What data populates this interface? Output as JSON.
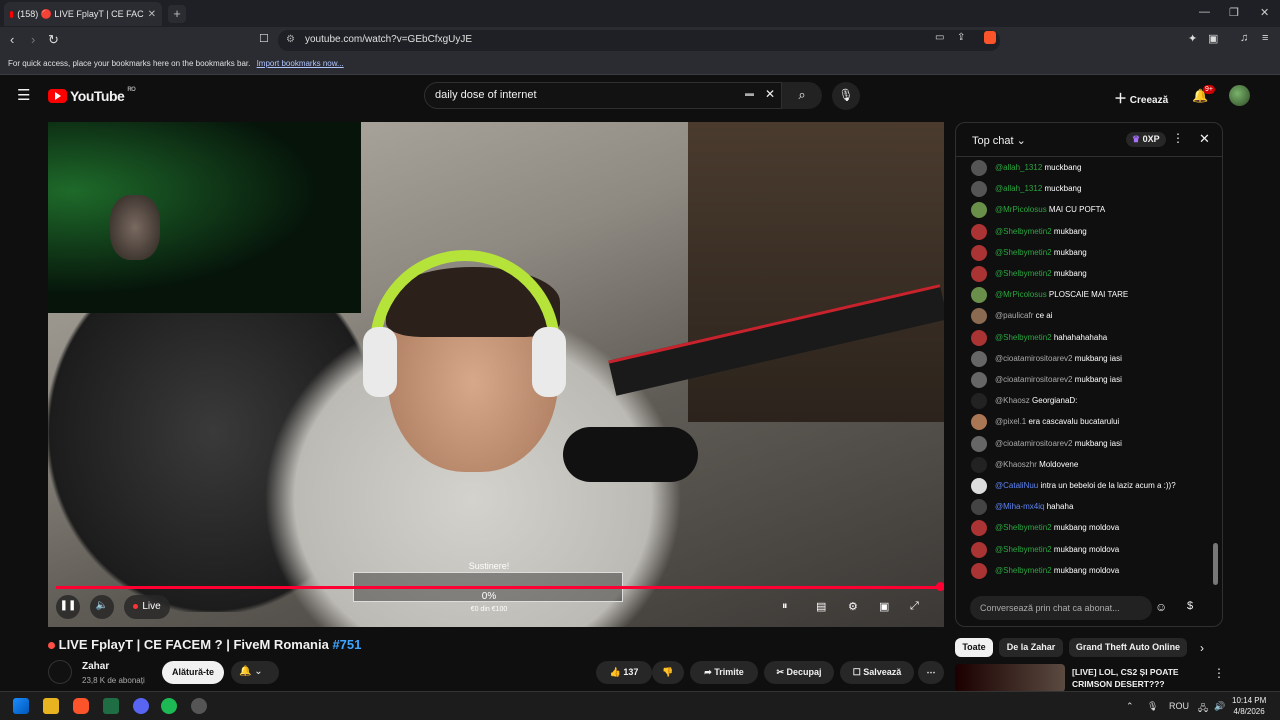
{
  "browser": {
    "tab_title": "(158) 🔴 LIVE FplayT | CE FAC",
    "tab_close": "✕",
    "new_tab": "+",
    "url": "youtube.com/watch?v=GEbCfxgUyJE",
    "bookmarks_hint": "For quick access, place your bookmarks here on the bookmarks bar.",
    "bookmarks_link": "Import bookmarks now...",
    "window_controls": [
      "—",
      "❐",
      "✕"
    ]
  },
  "youtube": {
    "logo_text": "YouTube",
    "country_code": "RO",
    "search_value": "daily dose of internet",
    "create_label": "Creează",
    "notif_badge": "9+"
  },
  "video": {
    "overlay_title": "Sustinere!",
    "overlay_percent": "0%",
    "overlay_amount": "€0 din €100",
    "progress": 1.0,
    "live_label": "Live"
  },
  "chat": {
    "title": "Top chat",
    "xp": "0XP",
    "messages": [
      {
        "user": "@allah_1312",
        "text": "muckbang",
        "style": "green",
        "av": "#555"
      },
      {
        "user": "@allah_1312",
        "text": "muckbang",
        "style": "green",
        "av": "#555"
      },
      {
        "user": "@MrPicolosus",
        "text": "MAI CU POFTA",
        "style": "green",
        "av": "#6a8f4a"
      },
      {
        "user": "@Shelbymetin2",
        "text": "mukbang",
        "style": "green",
        "av": "#a33"
      },
      {
        "user": "@Shelbymetin2",
        "text": "mukbang",
        "style": "green",
        "av": "#a33"
      },
      {
        "user": "@Shelbymetin2",
        "text": "mukbang",
        "style": "green",
        "av": "#a33"
      },
      {
        "user": "@MrPicolosus",
        "text": "PLOSCAIE MAI TARE",
        "style": "green",
        "av": "#6a8f4a"
      },
      {
        "user": "@paulicafr",
        "text": "ce ai",
        "style": "",
        "av": "#8a6a50"
      },
      {
        "user": "@Shelbymetin2",
        "text": "hahahahahaha",
        "style": "green",
        "av": "#a33"
      },
      {
        "user": "@cioatamirositoarev2",
        "text": "mukbang iasi",
        "style": "",
        "av": "#666"
      },
      {
        "user": "@cioatamirositoarev2",
        "text": "mukbang iasi",
        "style": "",
        "av": "#666"
      },
      {
        "user": "@Khaosz",
        "text": "GeorgianaD:",
        "style": "",
        "av": "#222"
      },
      {
        "user": "@pixel.1",
        "text": "era cascavalu bucatarului",
        "style": "",
        "av": "#aa7755"
      },
      {
        "user": "@cioatamirositoarev2",
        "text": "mukbang iasi",
        "style": "",
        "av": "#666"
      },
      {
        "user": "@Khaoszhr",
        "text": "Moldovene",
        "style": "",
        "av": "#222"
      },
      {
        "user": "@CataliNuu",
        "text": "intra un bebeloi de la laziz acum a :))?",
        "style": "blue",
        "av": "#ddd"
      },
      {
        "user": "@Miha-mx4iq",
        "text": "hahaha",
        "style": "blue",
        "av": "#444"
      },
      {
        "user": "@Shelbymetin2",
        "text": "mukbang moldova",
        "style": "green",
        "av": "#a33"
      },
      {
        "user": "@Shelbymetin2",
        "text": "mukbang moldova",
        "style": "green",
        "av": "#a33"
      },
      {
        "user": "@Shelbymetin2",
        "text": "mukbang moldova",
        "style": "green",
        "av": "#a33"
      }
    ],
    "input_placeholder": "Conversează prin chat ca abonat..."
  },
  "below": {
    "video_title": "LIVE FplayT | CE FACEM ? | FiveM Romania",
    "video_tag": "#751",
    "channel_name": "Zahar",
    "channel_subs": "23,8 K de abonați",
    "join_label": "Alătură-te",
    "likes": "137",
    "share_label": "Trimite",
    "clip_label": "Decupaj",
    "save_label": "Salvează",
    "chips": [
      "Toate",
      "De la Zahar",
      "Grand Theft Auto Online"
    ],
    "rec_title": "[LIVE] LOL, CS2 ȘI POATE CRIMSON DESERT???"
  },
  "taskbar": {
    "lang": "ROU",
    "time": "10:14 PM",
    "date": "4/8/2026"
  }
}
